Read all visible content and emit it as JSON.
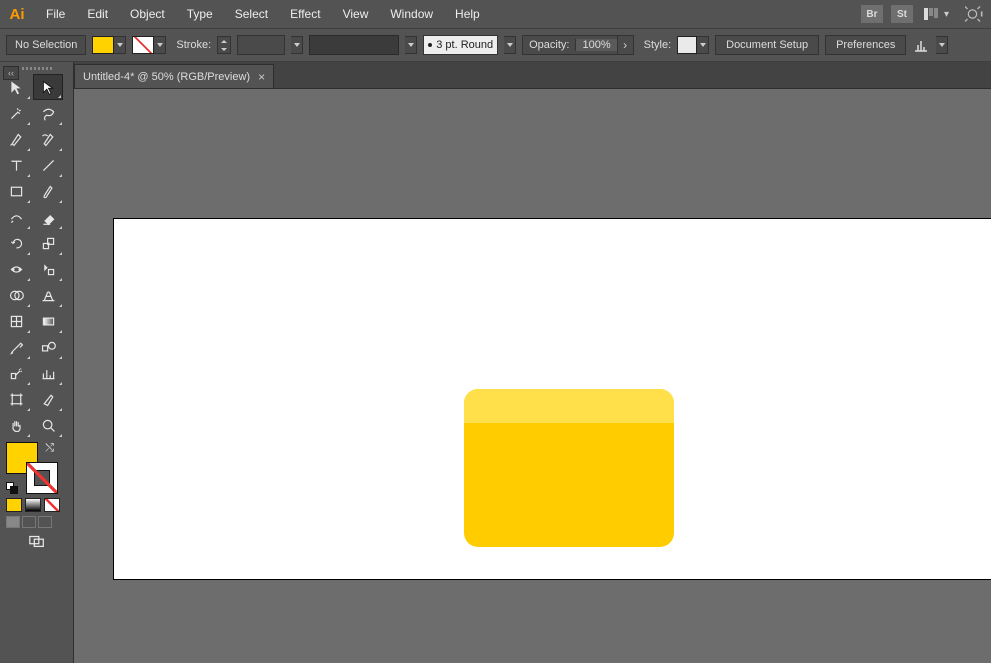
{
  "app": {
    "logo": "Ai"
  },
  "menu": {
    "file": "File",
    "edit": "Edit",
    "object": "Object",
    "type": "Type",
    "select": "Select",
    "effect": "Effect",
    "view": "View",
    "window": "Window",
    "help": "Help"
  },
  "topbar": {
    "badge_br": "Br",
    "badge_st": "St"
  },
  "optbar": {
    "selection_info": "No Selection",
    "stroke_label": "Stroke:",
    "brush_label": "3 pt. Round",
    "opacity_label": "Opacity:",
    "opacity_value": "100%",
    "style_label": "Style:",
    "doc_setup": "Document Setup",
    "prefs": "Preferences"
  },
  "doc": {
    "tab_title": "Untitled-4* @ 50% (RGB/Preview)"
  },
  "colors": {
    "fill": "#ffd200",
    "shape": "#ffcc00",
    "shape_shine": "#ffe04a"
  }
}
